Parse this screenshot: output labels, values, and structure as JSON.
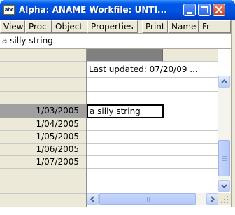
{
  "window": {
    "app_icon_text": "abc",
    "title": "Alpha: ANAME   Workfile: UNTI..."
  },
  "toolbar": {
    "buttons": [
      "View",
      "Proc",
      "Object",
      "Properties",
      "Print",
      "Name",
      "Fr"
    ]
  },
  "edit_field": {
    "value": "a silly string"
  },
  "grid": {
    "header_note": "Last updated: 07/20/09 ...",
    "active_cell_value": "a silly string",
    "rows": [
      {
        "label": "1/03/2005",
        "value": "a silly string",
        "selected": true
      },
      {
        "label": "1/04/2005",
        "value": ""
      },
      {
        "label": "1/05/2005",
        "value": ""
      },
      {
        "label": "1/06/2005",
        "value": ""
      },
      {
        "label": "1/07/2005",
        "value": ""
      }
    ]
  },
  "colors": {
    "titlebar": "#0054e3",
    "selected_row_header": "#a0a0a0",
    "column_header": "#808080"
  },
  "icons": [
    "abc-icon",
    "minimize-icon",
    "maximize-icon",
    "close-icon",
    "scroll-up-icon",
    "scroll-down-icon",
    "scroll-left-icon",
    "scroll-right-icon",
    "size-grip-icon"
  ]
}
